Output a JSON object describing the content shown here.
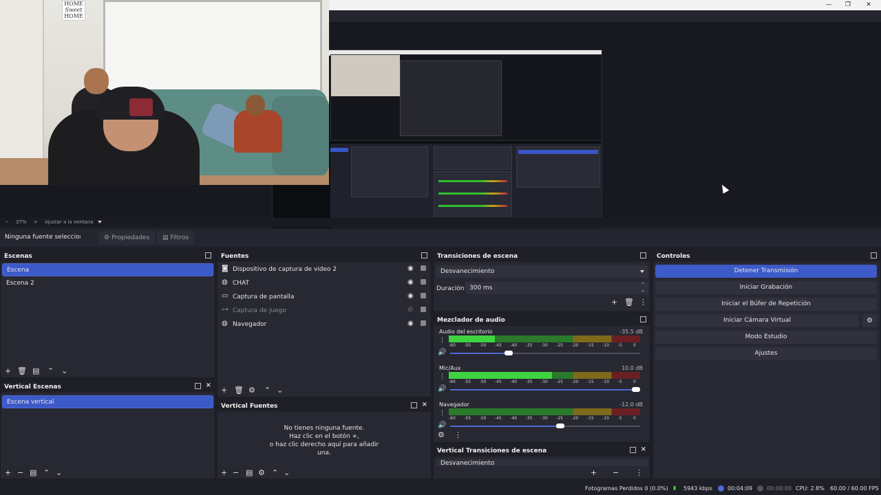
{
  "window": {
    "minimize": "—",
    "maximize": "❐",
    "close": "✕"
  },
  "preview": {
    "overlay_sign": [
      "HOME",
      "Sweet",
      "HOME"
    ]
  },
  "zoom_bar": {
    "minus": "−",
    "zoom": "37%",
    "plus": "+",
    "fit": "Ajustar a la ventana"
  },
  "source_toolbar": {
    "status": "Ninguna fuente seleccionad",
    "properties": "Propiedades",
    "filters": "Filtros"
  },
  "scenes": {
    "title": "Escenas",
    "items": [
      "Escena",
      "Escena 2"
    ],
    "selected": "Escena"
  },
  "vertical_scenes": {
    "title": "Vertical Escenas",
    "items": [
      "Escena vertical"
    ]
  },
  "sources": {
    "title": "Fuentes",
    "items": [
      {
        "label": "Dispositivo de captura de video 2",
        "icon": "camera-icon",
        "visible": true
      },
      {
        "label": "CHAT",
        "icon": "globe-icon",
        "visible": true
      },
      {
        "label": "Captura de pantalla",
        "icon": "monitor-icon",
        "visible": true
      },
      {
        "label": "Captura de juego",
        "icon": "gamepad-icon",
        "visible": false
      },
      {
        "label": "Navegador",
        "icon": "globe-icon",
        "visible": true
      }
    ]
  },
  "vertical_sources": {
    "title": "Vertical Fuentes",
    "empty_lines": [
      "No tienes ninguna fuente.",
      "Haz clic en el botón +,",
      "o haz clic derecho aquí para añadir",
      "una."
    ]
  },
  "transitions": {
    "title": "Transiciones de escena",
    "selected": "Desvanecimiento",
    "duration_label": "Duración",
    "duration_value": "300 ms"
  },
  "mixer": {
    "title": "Mezclador de audio",
    "ticks": [
      "-60",
      "-55",
      "-50",
      "-45",
      "-40",
      "-35",
      "-30",
      "-25",
      "-20",
      "-15",
      "-10",
      "-5",
      "0"
    ],
    "channels": [
      {
        "name": "Audio del escritorio",
        "db": "-35.5 dB",
        "level": 0.24,
        "volume": 0.33
      },
      {
        "name": "Mic/Aux",
        "db": "10.0 dB",
        "level": 0.54,
        "volume": 1.0
      },
      {
        "name": "Navegador",
        "db": "-12.0 dB",
        "level": 0.0,
        "volume": 0.6
      }
    ]
  },
  "vertical_transitions": {
    "title": "Vertical Transiciones de escena",
    "selected": "Desvanecimiento"
  },
  "controls": {
    "title": "Controles",
    "buttons": [
      "Detener Transmisión",
      "Iniciar Grabación",
      "Iniciar el Búfer de Repetición",
      "Iniciar Cámara Virtual",
      "Modo Estudio",
      "Ajustes"
    ]
  },
  "status": {
    "dropped": "Fotogramas Perdidos 0 (0.0%)",
    "bitrate": "5943 kbps",
    "stream_time": "00:04:09",
    "rec_time": "00:00:00",
    "cpu": "CPU: 2.8%",
    "fps": "60.00 / 60.00 FPS"
  },
  "colors": {
    "accent": "#3d5ac9",
    "panel": "#272831",
    "background": "#1e1f29"
  }
}
